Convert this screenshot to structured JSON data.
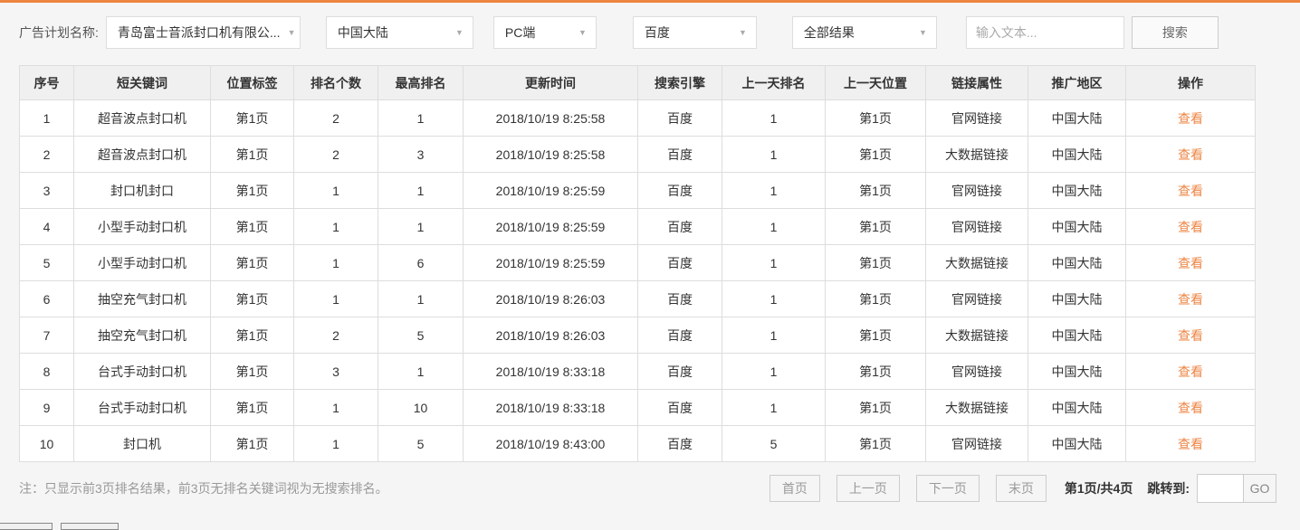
{
  "colors": {
    "accent_orange": "#ed8540",
    "link_orange": "#ed8544"
  },
  "filter_bar": {
    "label": "广告计划名称:",
    "dropdowns": [
      {
        "name": "ad-plan",
        "value": "青岛富士音派封口机有限公..."
      },
      {
        "name": "region",
        "value": "中国大陆"
      },
      {
        "name": "device",
        "value": "PC端"
      },
      {
        "name": "engine",
        "value": "百度"
      },
      {
        "name": "result-type",
        "value": "全部结果"
      }
    ],
    "search_input_placeholder": "输入文本...",
    "search_button_label": "搜索"
  },
  "table": {
    "headers": [
      "序号",
      "短关键词",
      "位置标签",
      "排名个数",
      "最高排名",
      "更新时间",
      "搜索引擎",
      "上一天排名",
      "上一天位置",
      "链接属性",
      "推广地区",
      "操作"
    ],
    "action_label": "查看",
    "rows": [
      [
        "1",
        "超音波点封口机",
        "第1页",
        "2",
        "1",
        "2018/10/19 8:25:58",
        "百度",
        "1",
        "第1页",
        "官网链接",
        "中国大陆"
      ],
      [
        "2",
        "超音波点封口机",
        "第1页",
        "2",
        "3",
        "2018/10/19 8:25:58",
        "百度",
        "1",
        "第1页",
        "大数据链接",
        "中国大陆"
      ],
      [
        "3",
        "封口机封口",
        "第1页",
        "1",
        "1",
        "2018/10/19 8:25:59",
        "百度",
        "1",
        "第1页",
        "官网链接",
        "中国大陆"
      ],
      [
        "4",
        "小型手动封口机",
        "第1页",
        "1",
        "1",
        "2018/10/19 8:25:59",
        "百度",
        "1",
        "第1页",
        "官网链接",
        "中国大陆"
      ],
      [
        "5",
        "小型手动封口机",
        "第1页",
        "1",
        "6",
        "2018/10/19 8:25:59",
        "百度",
        "1",
        "第1页",
        "大数据链接",
        "中国大陆"
      ],
      [
        "6",
        "抽空充气封口机",
        "第1页",
        "1",
        "1",
        "2018/10/19 8:26:03",
        "百度",
        "1",
        "第1页",
        "官网链接",
        "中国大陆"
      ],
      [
        "7",
        "抽空充气封口机",
        "第1页",
        "2",
        "5",
        "2018/10/19 8:26:03",
        "百度",
        "1",
        "第1页",
        "大数据链接",
        "中国大陆"
      ],
      [
        "8",
        "台式手动封口机",
        "第1页",
        "3",
        "1",
        "2018/10/19 8:33:18",
        "百度",
        "1",
        "第1页",
        "官网链接",
        "中国大陆"
      ],
      [
        "9",
        "台式手动封口机",
        "第1页",
        "1",
        "10",
        "2018/10/19 8:33:18",
        "百度",
        "1",
        "第1页",
        "大数据链接",
        "中国大陆"
      ],
      [
        "10",
        "封口机",
        "第1页",
        "1",
        "5",
        "2018/10/19 8:43:00",
        "百度",
        "5",
        "第1页",
        "官网链接",
        "中国大陆"
      ]
    ]
  },
  "footer": {
    "note": "注：只显示前3页排名结果，前3页无排名关键词视为无搜索排名。",
    "pagination": {
      "first_label": "首页",
      "prev_label": "上一页",
      "next_label": "下一页",
      "last_label": "末页",
      "page_info": "第1页/共4页",
      "jump_label": "跳转到:",
      "jump_value": "",
      "go_label": "GO"
    }
  }
}
